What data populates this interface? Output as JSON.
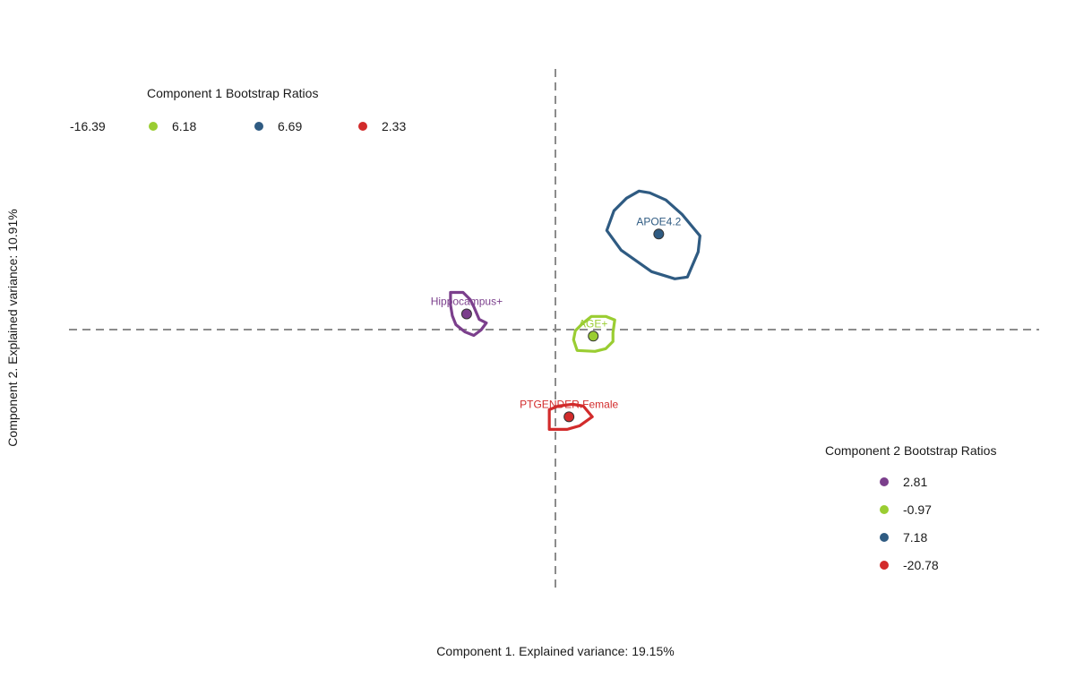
{
  "chart_data": {
    "type": "scatter",
    "xlabel": "Component 1. Explained variance: 19.15%",
    "ylabel": "Component 2. Explained variance: 10.91%",
    "xlim": [
      -1,
      1
    ],
    "ylim": [
      -1,
      1
    ],
    "grid": false,
    "reference_lines": {
      "x": 0,
      "y": 0,
      "style": "dashed"
    },
    "points": [
      {
        "label": "Hippocampus+",
        "x": -0.183,
        "y": 0.06,
        "color": "#7B3F8C"
      },
      {
        "label": "AGE+",
        "x": 0.078,
        "y": -0.025,
        "color": "#9ACD32"
      },
      {
        "label": "APOE4.2",
        "x": 0.213,
        "y": 0.366,
        "color": "#2F5B82"
      },
      {
        "label": "PTGENDER.Female",
        "x": 0.028,
        "y": -0.334,
        "color": "#D22B2B"
      }
    ],
    "legend_component1": {
      "title": "Component 1 Bootstrap Ratios",
      "entries": [
        {
          "value": "-16.39",
          "color": "#7B3F8C"
        },
        {
          "value": "6.18",
          "color": "#9ACD32"
        },
        {
          "value": "6.69",
          "color": "#2F5B82"
        },
        {
          "value": "2.33",
          "color": "#D22B2B"
        }
      ]
    },
    "legend_component2": {
      "title": "Component 2 Bootstrap Ratios",
      "entries": [
        {
          "value": "2.81",
          "color": "#7B3F8C"
        },
        {
          "value": "-0.97",
          "color": "#9ACD32"
        },
        {
          "value": "7.18",
          "color": "#2F5B82"
        },
        {
          "value": "-20.78",
          "color": "#D22B2B"
        }
      ]
    }
  }
}
